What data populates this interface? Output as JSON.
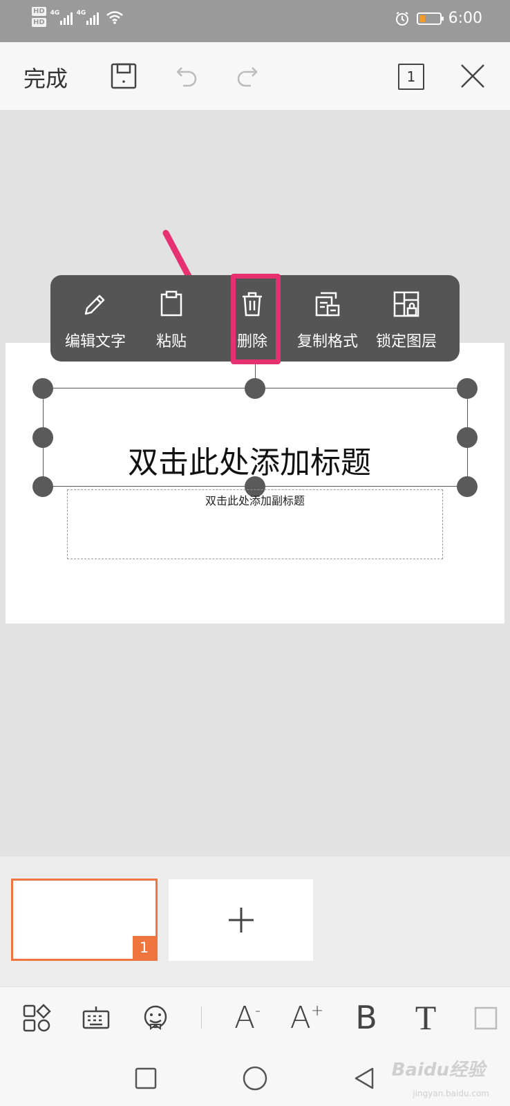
{
  "status_bar": {
    "hd1": "HD",
    "hd2": "HD",
    "sig1": "4G",
    "sig2": "4G",
    "time": "6:00"
  },
  "toolbar": {
    "done_label": "完成",
    "page_count": "1"
  },
  "slide": {
    "title_placeholder": "双击此处添加标题",
    "subtitle_placeholder": "双击此处添加副标题"
  },
  "context_menu": {
    "items": [
      {
        "label": "编辑文字",
        "icon": "pencil-icon"
      },
      {
        "label": "粘贴",
        "icon": "clipboard-icon"
      },
      {
        "label": "删除",
        "icon": "trash-icon"
      },
      {
        "label": "复制格式",
        "icon": "copy-format-icon"
      },
      {
        "label": "锁定图层",
        "icon": "lock-layer-icon"
      }
    ],
    "highlighted_item": "删除"
  },
  "thumbnails": {
    "slide1_number": "1"
  },
  "bottom_toolbar": {
    "items": [
      "layout-icon",
      "keyboard-icon",
      "emoji-icon",
      "font-decrease",
      "font-increase",
      "bold",
      "text-style",
      "more"
    ],
    "font_decrease_label": "A",
    "font_increase_label": "A",
    "bold_label": "B",
    "text_label": "T"
  },
  "watermark": {
    "brand": "Baidu经验",
    "url": "jingyan.baidu.com"
  },
  "colors": {
    "accent": "#f0743d",
    "highlight": "#e6306f",
    "menu_bg": "#555555",
    "battery": "#f19a27"
  }
}
